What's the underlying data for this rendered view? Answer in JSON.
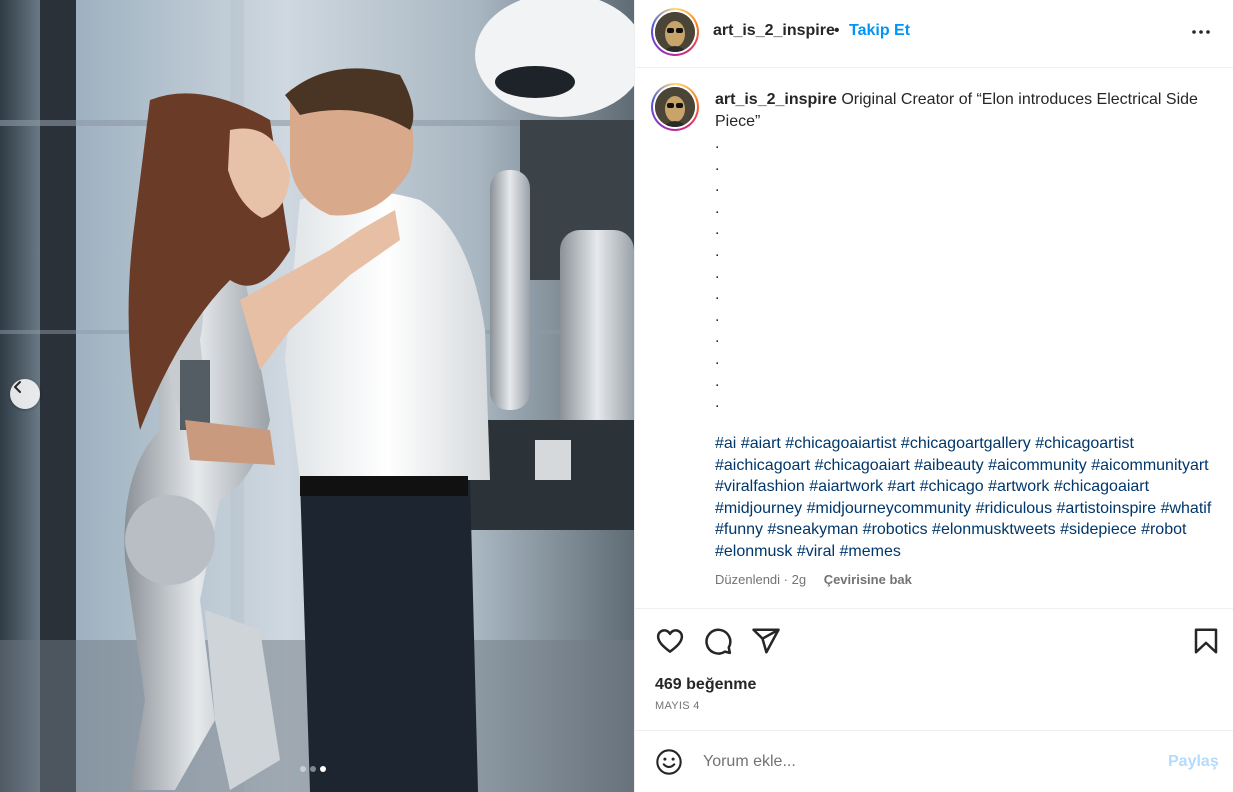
{
  "post": {
    "username": "art_is_2_inspire",
    "bullet": "•",
    "follow_label": "Takip Et",
    "more_icon": "more-horizontal-icon"
  },
  "caption": {
    "username": "art_is_2_inspire",
    "text": "Original Creator of “Elon introduces Electrical Side Piece”",
    "dots": [
      ".",
      ".",
      ".",
      ".",
      ".",
      ".",
      ".",
      ".",
      ".",
      ".",
      ".",
      ".",
      "."
    ],
    "hashtags": [
      "#ai",
      "#aiart",
      "#chicagoaiartist",
      "#chicagoartgallery",
      "#chicagoartist",
      "#aichicagoart",
      "#chicagoaiart",
      "#aibeauty",
      "#aicommunity",
      "#aicommunityart",
      "#viralfashion",
      "#aiartwork",
      "#art",
      "#chicago",
      "#artwork",
      "#chicagoaiart",
      "#midjourney",
      "#midjourneycommunity",
      "#ridiculous",
      "#artistoinspire",
      "#whatif",
      "#funny",
      "#sneakyman",
      "#robotics",
      "#elonmusktweets",
      "#sidepiece",
      "#robot",
      "#elonmusk",
      "#viral",
      "#memes"
    ],
    "edited": "Düzenlendi · 2g",
    "see_translation": "Çevirisine bak"
  },
  "actions": {
    "like_icon": "heart-icon",
    "comment_icon": "comment-icon",
    "share_icon": "share-icon",
    "save_icon": "bookmark-icon"
  },
  "likes": "469 beğenme",
  "date": "MAYIS 4",
  "comment": {
    "placeholder": "Yorum ekle...",
    "post_label": "Paylaş",
    "emoji_icon": "emoji-icon"
  },
  "carousel": {
    "prev_icon": "chevron-left-icon",
    "slide_count": 3,
    "active_index": 2
  },
  "colors": {
    "accent": "#0095f6",
    "hashtag": "#00376b",
    "muted": "#737373",
    "post_disabled": "#b3dbff"
  }
}
